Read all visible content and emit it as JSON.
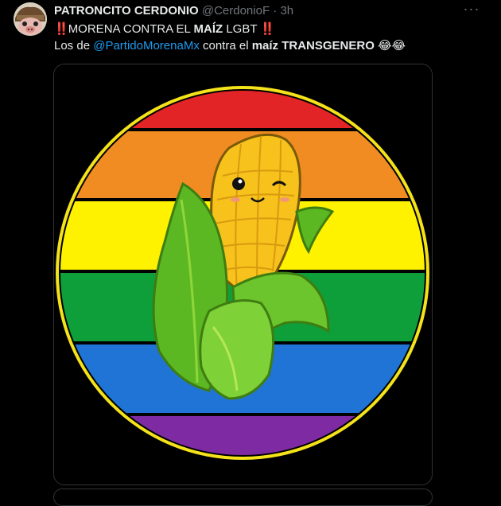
{
  "tweet": {
    "display_name": "PATRONCITO CERDONIO",
    "handle": "@CerdonioF",
    "separator": "·",
    "time": "3h",
    "more_icon": "more-horizontal-icon",
    "line1": {
      "emoji_left": "‼️",
      "part1": "MORENA CONTRA EL ",
      "bold": "MAÍZ",
      "part2": " LGBT ",
      "emoji_right": "‼️"
    },
    "line2": {
      "prefix": "Los de ",
      "mention": "@PartidoMorenaMx",
      "middle": " contra el ",
      "bold": "maíz TRANSGENERO",
      "emoji": "😂😂"
    }
  },
  "media": {
    "icon": "corn-cob-rainbow-circle-illustration",
    "colors": {
      "red": "#e32426",
      "orange": "#f08c21",
      "yellow": "#fef200",
      "green": "#0e9f3b",
      "blue": "#1f74d6",
      "purple": "#7e2aa3",
      "ring": "#f4e21a"
    }
  }
}
